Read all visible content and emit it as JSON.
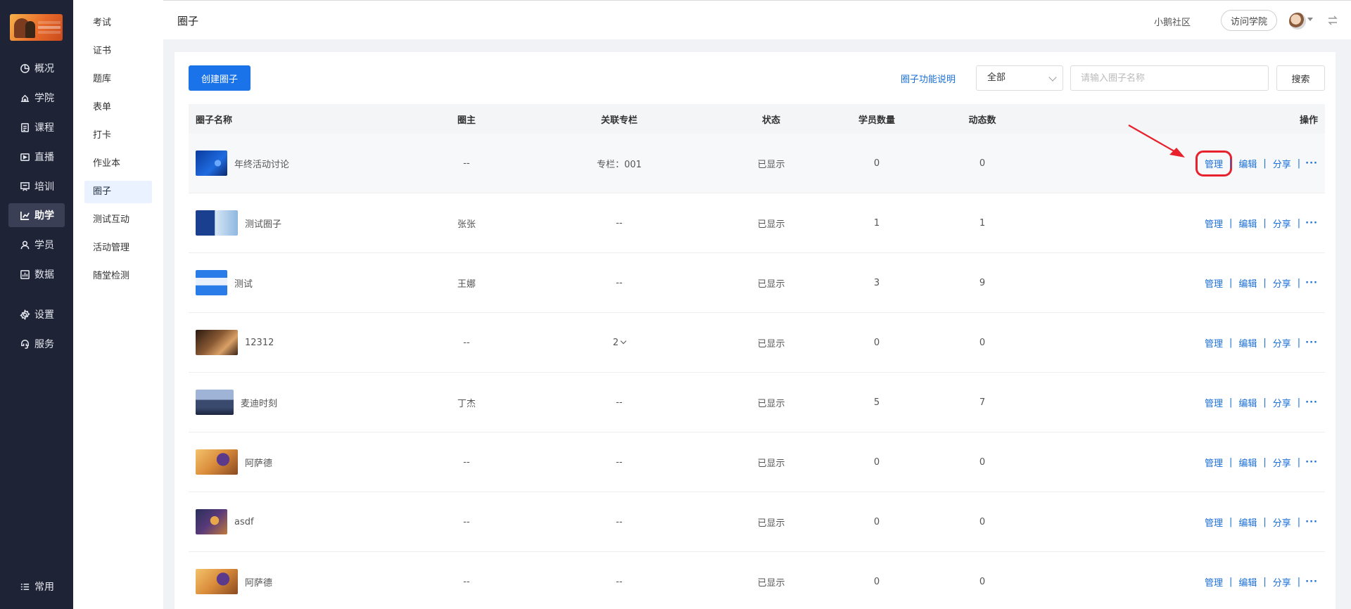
{
  "nav": {
    "items": [
      {
        "label": "概况",
        "icon": "pie-chart-icon"
      },
      {
        "label": "学院",
        "icon": "academy-icon"
      },
      {
        "label": "课程",
        "icon": "course-icon"
      },
      {
        "label": "直播",
        "icon": "live-icon"
      },
      {
        "label": "培训",
        "icon": "training-icon"
      },
      {
        "label": "助学",
        "icon": "study-aid-icon",
        "active": true
      },
      {
        "label": "学员",
        "icon": "user-icon"
      },
      {
        "label": "数据",
        "icon": "data-icon"
      },
      {
        "label": "设置",
        "icon": "gear-icon"
      },
      {
        "label": "服务",
        "icon": "service-icon"
      }
    ],
    "bottom": {
      "label": "常用",
      "icon": "menu-icon"
    }
  },
  "subnav": {
    "items": [
      "考试",
      "证书",
      "题库",
      "表单",
      "打卡",
      "作业本",
      "圈子",
      "测试互动",
      "活动管理",
      "随堂检测"
    ],
    "active": "圈子"
  },
  "topbar": {
    "title": "圈子",
    "community": "小鹅社区",
    "visit_button": "访问学院"
  },
  "toolbar": {
    "create_button": "创建圈子",
    "help_link": "圈子功能说明",
    "filter_value": "全部",
    "search_placeholder": "请输入圈子名称",
    "search_button": "搜索"
  },
  "table": {
    "headers": {
      "name": "圈子名称",
      "owner": "圈主",
      "column": "关联专栏",
      "status": "状态",
      "members": "学员数量",
      "posts": "动态数",
      "ops": "操作"
    },
    "ops_labels": {
      "manage": "管理",
      "edit": "编辑",
      "share": "分享",
      "more": "···",
      "sep": "|"
    },
    "rows": [
      {
        "name": "年终活动讨论",
        "owner": "--",
        "column": "专栏：001",
        "status": "已显示",
        "members": "0",
        "posts": "0"
      },
      {
        "name": "测试圈子",
        "owner": "张张",
        "column": "--",
        "status": "已显示",
        "members": "1",
        "posts": "1"
      },
      {
        "name": "测试",
        "owner": "王娜",
        "column": "--",
        "status": "已显示",
        "members": "3",
        "posts": "9"
      },
      {
        "name": "12312",
        "owner": "--",
        "column": "2",
        "status": "已显示",
        "members": "0",
        "posts": "0"
      },
      {
        "name": "麦迪时刻",
        "owner": "丁杰",
        "column": "--",
        "status": "已显示",
        "members": "5",
        "posts": "7"
      },
      {
        "name": "阿萨德",
        "owner": "--",
        "column": "--",
        "status": "已显示",
        "members": "0",
        "posts": "0"
      },
      {
        "name": "asdf",
        "owner": "--",
        "column": "--",
        "status": "已显示",
        "members": "0",
        "posts": "0"
      },
      {
        "name": "阿萨德",
        "owner": "--",
        "column": "--",
        "status": "已显示",
        "members": "0",
        "posts": "0"
      }
    ]
  },
  "colors": {
    "nav_bg": "#1f2336",
    "primary": "#1a73e8",
    "link": "#1a6fd6",
    "highlight": "#e8222d"
  }
}
